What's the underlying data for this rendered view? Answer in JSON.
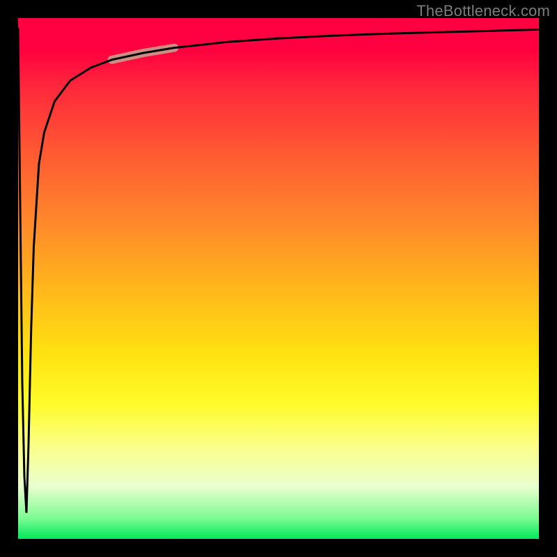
{
  "watermark": "TheBottleneck.com",
  "chart_data": {
    "type": "line",
    "title": "",
    "xlabel": "",
    "ylabel": "",
    "xlim": [
      0,
      100
    ],
    "ylim": [
      0,
      100
    ],
    "grid": false,
    "series": [
      {
        "name": "bottleneck-curve",
        "x": [
          0,
          0.8,
          1.2,
          1.6,
          2.0,
          2.5,
          3.0,
          4.0,
          5.0,
          7.0,
          10.0,
          14.0,
          18.0,
          24.0,
          30.0,
          40.0,
          50.0,
          60.0,
          70.0,
          85.0,
          100.0
        ],
        "values": [
          98,
          30,
          12,
          5,
          18,
          40,
          56,
          72,
          78,
          84,
          88.0,
          90.5,
          92.0,
          93.3,
          94.3,
          95.4,
          96.1,
          96.6,
          97.0,
          97.4,
          97.8
        ]
      }
    ],
    "highlight": {
      "x_start": 18,
      "x_end": 30,
      "color": "#cd8d83",
      "width": 12
    }
  },
  "gradient": {
    "top": "#ff0040",
    "mid": "#ffe411",
    "bottom": "#00e85f"
  }
}
